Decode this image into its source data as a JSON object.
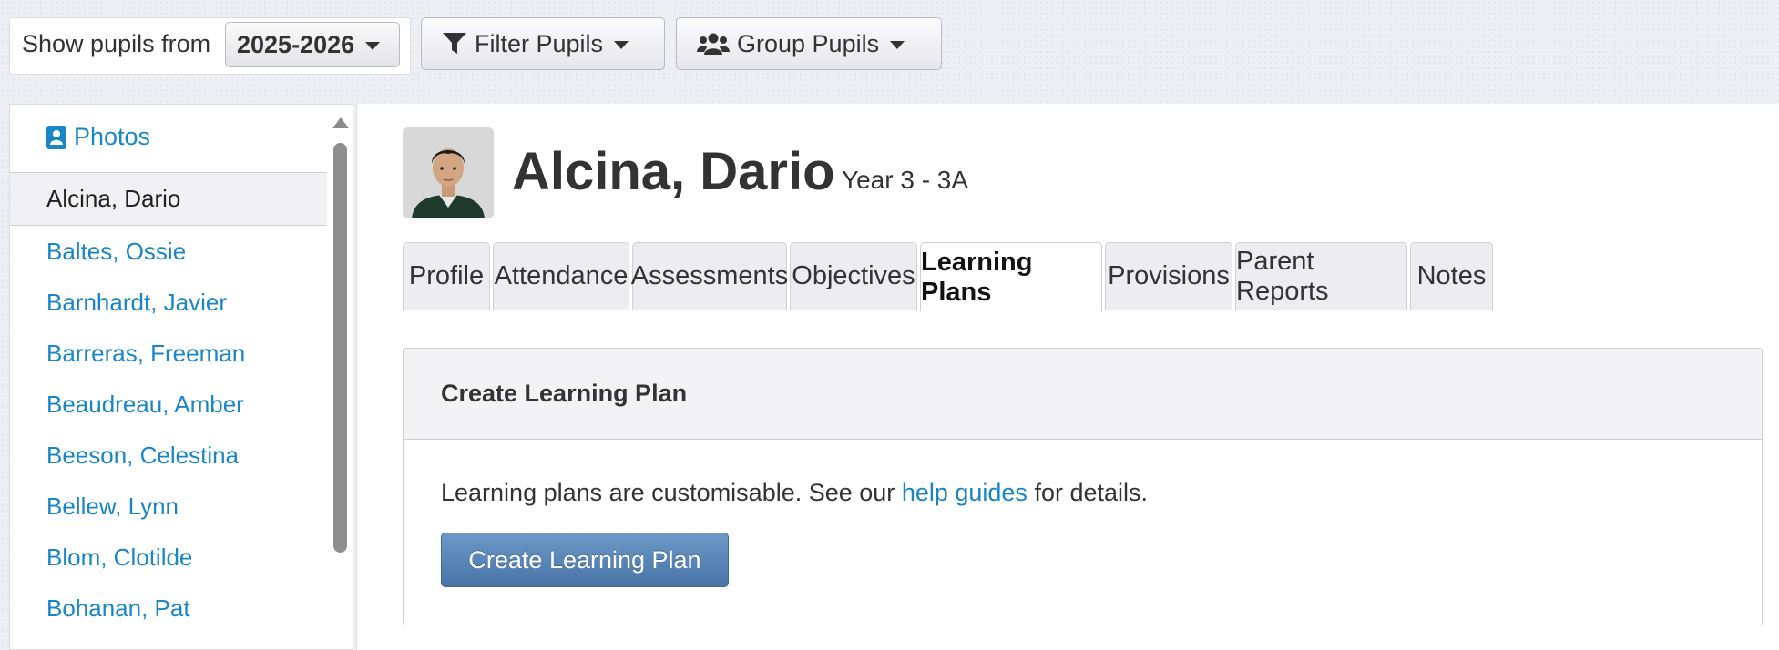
{
  "toolbar": {
    "show_label": "Show pupils from",
    "year_value": "2025-2026",
    "filter_label": "Filter Pupils",
    "group_label": "Group Pupils"
  },
  "sidebar": {
    "photos_label": "Photos",
    "pupils": [
      "Alcina, Dario",
      "Baltes, Ossie",
      "Barnhardt, Javier",
      "Barreras, Freeman",
      "Beaudreau, Amber",
      "Beeson, Celestina",
      "Bellew, Lynn",
      "Blom, Clotilde",
      "Bohanan, Pat"
    ],
    "active_index": 0
  },
  "header": {
    "name": "Alcina, Dario",
    "class": "Year 3 - 3A"
  },
  "tabs": [
    "Profile",
    "Attendance",
    "Assessments",
    "Objectives",
    "Learning Plans",
    "Provisions",
    "Parent Reports",
    "Notes"
  ],
  "active_tab": "Learning Plans",
  "panel": {
    "title": "Create Learning Plan",
    "text_before": "Learning plans are customisable. See our ",
    "link_text": "help guides",
    "text_after": " for details.",
    "button_label": "Create Learning Plan"
  },
  "colors": {
    "link": "#1a85c7",
    "primary_button": "#5683b5",
    "background": "#eeeef5"
  }
}
